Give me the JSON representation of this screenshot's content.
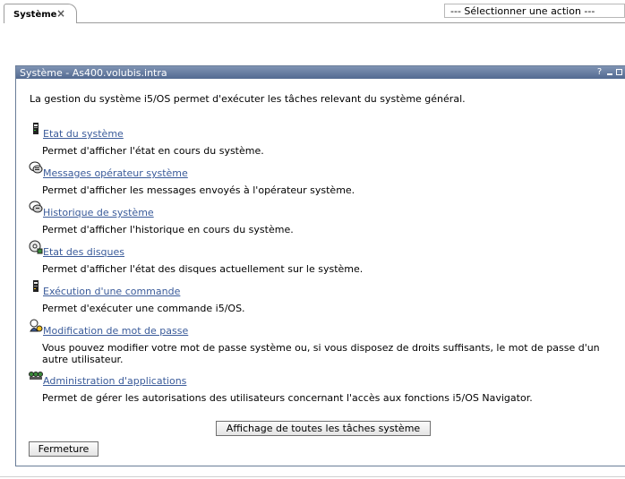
{
  "tab": {
    "label": "Système",
    "close_glyph": "×"
  },
  "action_select": {
    "selected": "--- Sélectionner une action ---"
  },
  "portlet": {
    "title": "Système - As400.volubis.intra",
    "help_glyph": "?",
    "intro": "La gestion du système i5/OS permet d'exécuter les tâches relevant du système général.",
    "tasks": [
      {
        "icon": "system-status-icon",
        "link": "Etat du système",
        "desc": "Permet d'afficher l'état en cours du système."
      },
      {
        "icon": "messages-icon",
        "link": "Messages opérateur système",
        "desc": "Permet d'afficher les messages envoyés à l'opérateur système."
      },
      {
        "icon": "history-icon",
        "link": "Historique de système",
        "desc": "Permet d'afficher l'historique en cours du système."
      },
      {
        "icon": "disk-status-icon",
        "link": "Etat des disques",
        "desc": "Permet d'afficher l'état des disques actuellement sur le système."
      },
      {
        "icon": "run-command-icon",
        "link": "Exécution d'une commande",
        "desc": "Permet d'exécuter une commande i5/OS."
      },
      {
        "icon": "password-icon",
        "link": "Modification de mot de passe",
        "desc": "Vous pouvez modifier votre mot de passe système ou, si vous disposez de droits suffisants, le mot de passe d'un autre utilisateur."
      },
      {
        "icon": "app-admin-icon",
        "link": "Administration d'applications",
        "desc": "Permet de gérer les autorisations des utilisateurs concernant l'accès aux fonctions i5/OS Navigator."
      }
    ],
    "show_all_button": "Affichage de toutes les tâches système",
    "close_button": "Fermeture"
  }
}
